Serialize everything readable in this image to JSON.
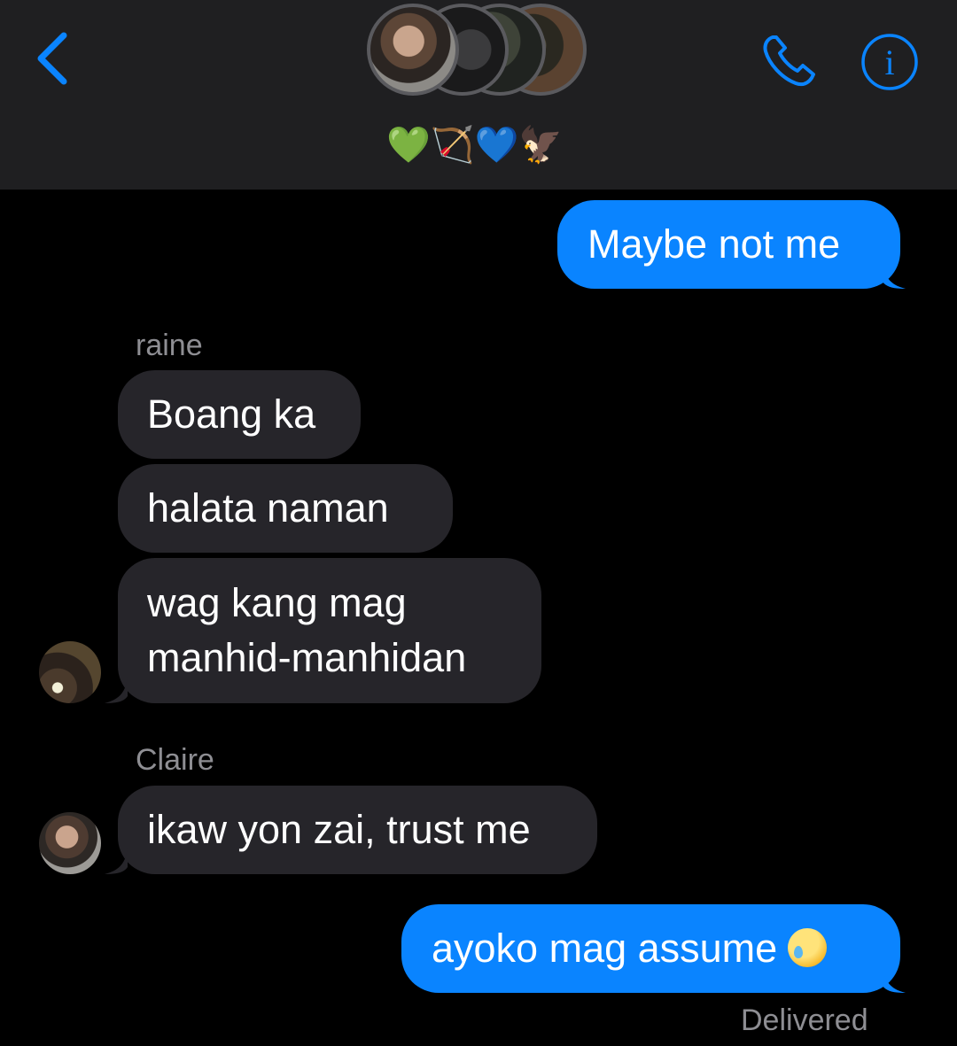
{
  "header": {
    "back_icon": "chevron-left-icon",
    "phone_icon": "phone-icon",
    "info_icon": "info-icon",
    "group_name": "💚🏹💙🦅",
    "accent_color": "#0a84ff",
    "background_color": "#1f1f21"
  },
  "messages": [
    {
      "direction": "outgoing",
      "text": "Maybe not me"
    },
    {
      "direction": "incoming",
      "sender": "raine",
      "text": "Boang ka"
    },
    {
      "direction": "incoming",
      "sender": "raine",
      "text": "halata naman"
    },
    {
      "direction": "incoming",
      "sender": "raine",
      "text_line1": "wag kang mag",
      "text_line2": "manhid-manhidan"
    },
    {
      "direction": "incoming",
      "sender": "Claire",
      "text": "ikaw yon zai, trust me"
    },
    {
      "direction": "outgoing",
      "text": "ayoko mag assume",
      "emoji": "🥲"
    }
  ],
  "status": {
    "delivered": "Delivered"
  },
  "colors": {
    "outgoing_bubble": "#0a84ff",
    "incoming_bubble": "#26252a",
    "secondary_text": "#8e8e93"
  }
}
